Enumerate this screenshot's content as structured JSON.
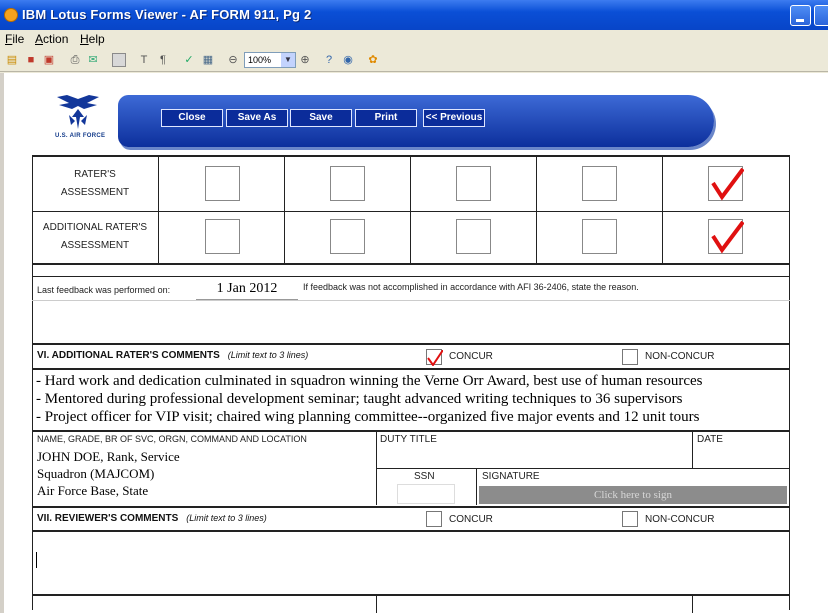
{
  "window": {
    "title": "IBM Lotus Forms Viewer - AF FORM 911, Pg 2"
  },
  "menu": {
    "file": "File",
    "action": "Action",
    "help": "Help"
  },
  "toolbar": {
    "zoom": "100%"
  },
  "header": {
    "logo_text": "U.S. AIR FORCE",
    "close": "Close",
    "save_as": "Save As",
    "save": "Save",
    "print": "Print",
    "previous": "<< Previous"
  },
  "assessment": {
    "rater_line1": "RATER'S",
    "rater_line2": "ASSESSMENT",
    "add_rater_line1": "ADDITIONAL RATER'S",
    "add_rater_line2": "ASSESSMENT",
    "rater_checked_column": 5,
    "add_rater_checked_column": 5
  },
  "feedback": {
    "label": "Last feedback was performed on:",
    "date": "1 Jan 2012",
    "note": "If feedback was not accomplished in accordance with AFI 36-2406, state the reason."
  },
  "section6": {
    "title": "VI.  ADDITIONAL RATER'S COMMENTS",
    "limit": "(Limit text to 3 lines)",
    "concur": "CONCUR",
    "non_concur": "NON-CONCUR",
    "concur_checked": true,
    "comments": [
      "- Hard work and dedication culminated in squadron winning the Verne Orr Award, best use of human resources",
      "- Mentored during professional development seminar; taught advanced writing techniques to 36 supervisors",
      "- Project officer for VIP visit; chaired wing planning committee--organized five major events and 12 unit tours"
    ]
  },
  "signature_block": {
    "name_label": "NAME, GRADE, BR OF SVC, ORGN, COMMAND AND LOCATION",
    "name_line1": "JOHN DOE, Rank, Service",
    "name_line2": "Squadron (MAJCOM)",
    "name_line3": "Air Force Base, State",
    "duty_title_label": "DUTY TITLE",
    "date_label": "DATE",
    "ssn_label": "SSN",
    "signature_label": "SIGNATURE",
    "sign_button": "Click here to sign"
  },
  "section7": {
    "title": "VII.  REVIEWER'S COMMENTS",
    "limit": "(Limit text to 3 lines)",
    "concur": "CONCUR",
    "non_concur": "NON-CONCUR"
  }
}
